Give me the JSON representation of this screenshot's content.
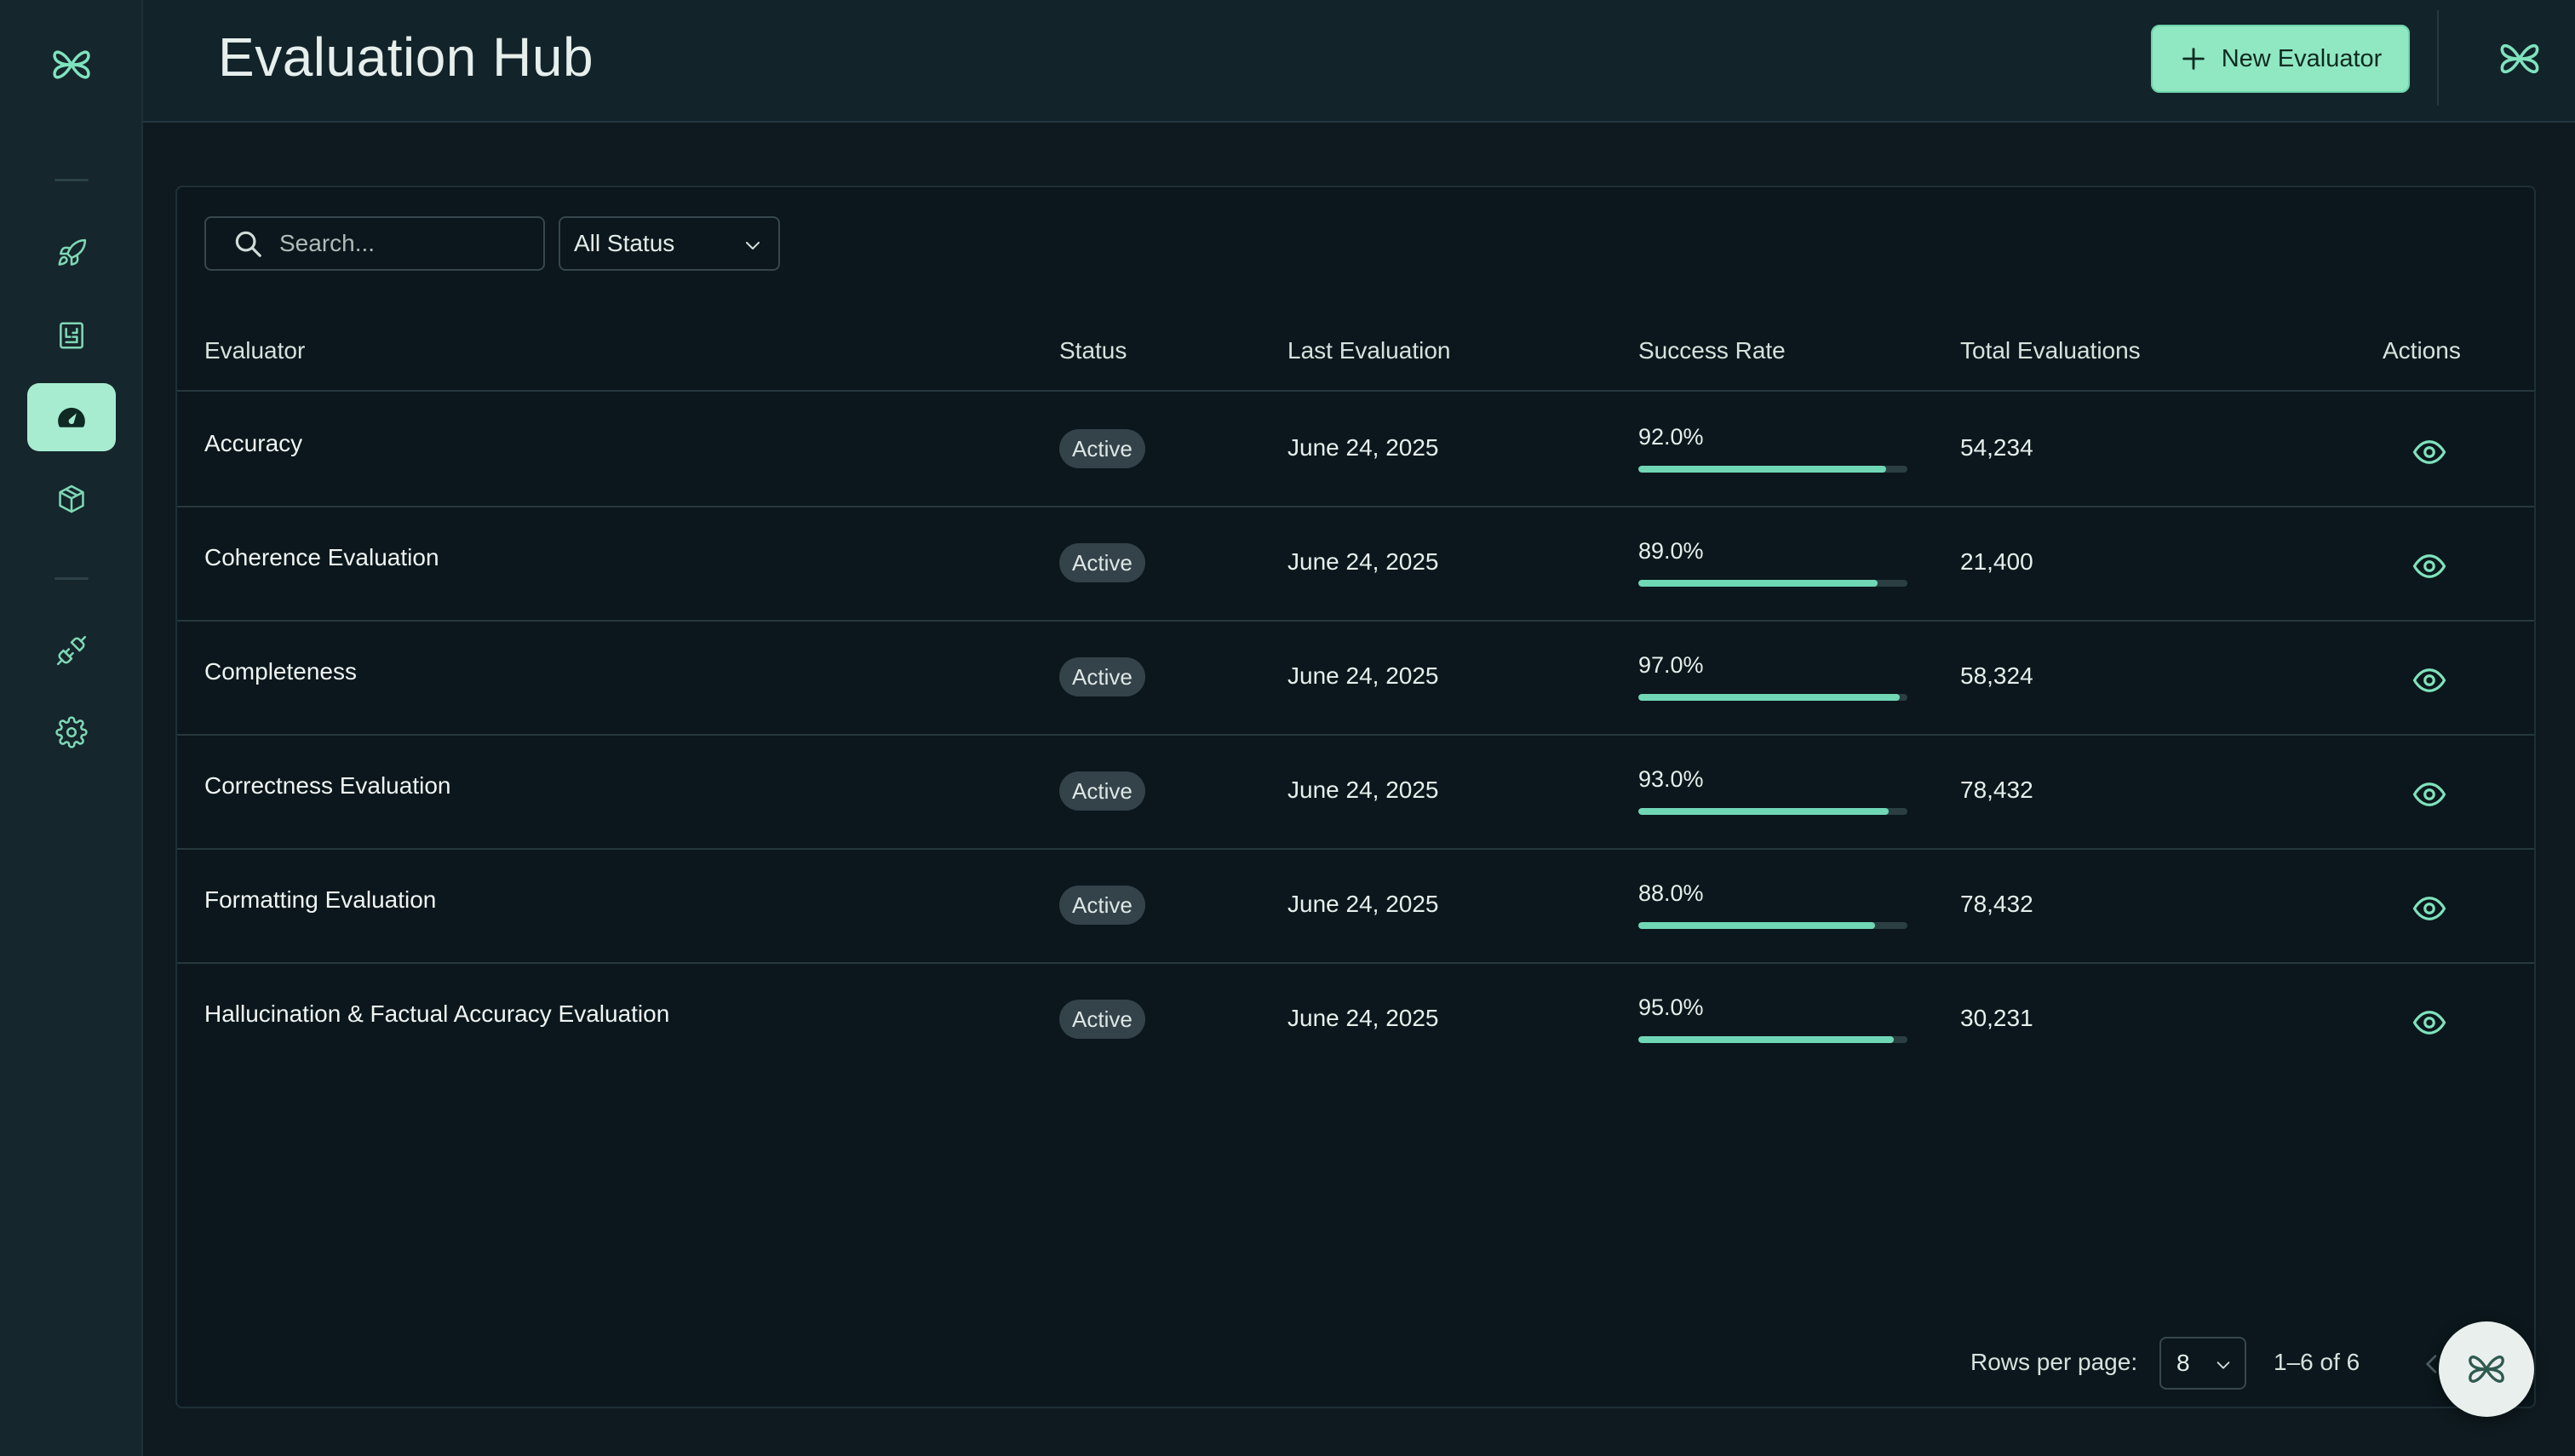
{
  "header": {
    "title": "Evaluation Hub",
    "new_button_label": "New Evaluator"
  },
  "sidebar": {
    "items": [
      {
        "icon": "rocket-icon",
        "active": false
      },
      {
        "icon": "blueprint-icon",
        "active": false
      },
      {
        "icon": "dashboard-gauge-icon",
        "active": true
      },
      {
        "icon": "cube-icon",
        "active": false
      },
      {
        "icon": "plug-icon",
        "active": false
      },
      {
        "icon": "gear-icon",
        "active": false
      }
    ]
  },
  "filters": {
    "search_placeholder": "Search...",
    "status_selected": "All Status"
  },
  "table": {
    "columns": [
      "Evaluator",
      "Status",
      "Last Evaluation",
      "Success Rate",
      "Total Evaluations",
      "Actions"
    ],
    "rows": [
      {
        "name": "Accuracy",
        "status": "Active",
        "last_evaluation": "June 24, 2025",
        "success_rate": "92.0%",
        "success_fraction": 0.92,
        "total": "54,234"
      },
      {
        "name": "Coherence Evaluation",
        "status": "Active",
        "last_evaluation": "June 24, 2025",
        "success_rate": "89.0%",
        "success_fraction": 0.89,
        "total": "21,400"
      },
      {
        "name": "Completeness",
        "status": "Active",
        "last_evaluation": "June 24, 2025",
        "success_rate": "97.0%",
        "success_fraction": 0.97,
        "total": "58,324"
      },
      {
        "name": "Correctness Evaluation",
        "status": "Active",
        "last_evaluation": "June 24, 2025",
        "success_rate": "93.0%",
        "success_fraction": 0.93,
        "total": "78,432"
      },
      {
        "name": "Formatting Evaluation",
        "status": "Active",
        "last_evaluation": "June 24, 2025",
        "success_rate": "88.0%",
        "success_fraction": 0.88,
        "total": "78,432"
      },
      {
        "name": "Hallucination & Factual Accuracy Evaluation",
        "status": "Active",
        "last_evaluation": "June 24, 2025",
        "success_rate": "95.0%",
        "success_fraction": 0.95,
        "total": "30,231"
      }
    ]
  },
  "pagination": {
    "rows_per_page_label": "Rows per page:",
    "rows_per_page_value": "8",
    "range": "1–6 of 6"
  },
  "colors": {
    "accent": "#8fe8c2",
    "bar_fill": "#70d7b6",
    "background": "#0e1a1f"
  }
}
